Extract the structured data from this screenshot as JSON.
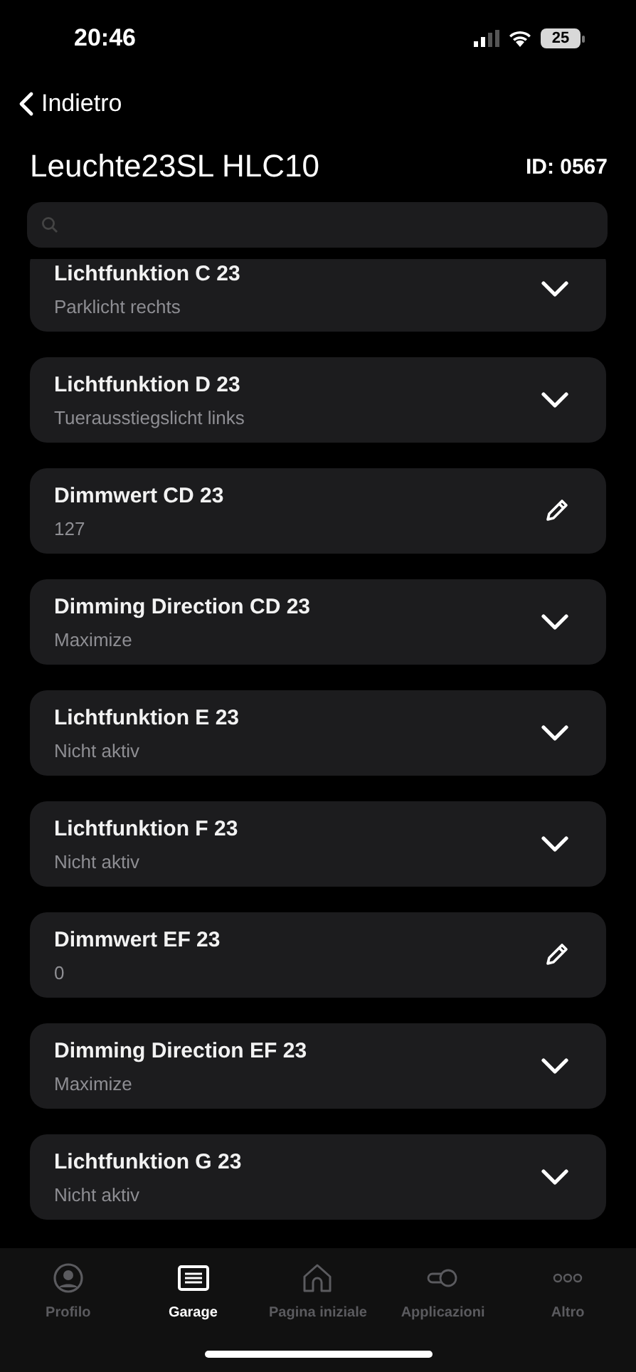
{
  "status_bar": {
    "time": "20:46",
    "battery": "25"
  },
  "nav": {
    "back": "Indietro"
  },
  "header": {
    "title": "Leuchte23SL HLC10",
    "id": "ID: 0567"
  },
  "items": [
    {
      "title": "Lichtfunktion C 23",
      "value": "Parklicht rechts",
      "kind": "select"
    },
    {
      "title": "Lichtfunktion D 23",
      "value": "Tuerausstiegslicht links",
      "kind": "select"
    },
    {
      "title": "Dimmwert CD 23",
      "value": "127",
      "kind": "edit"
    },
    {
      "title": "Dimming Direction CD 23",
      "value": "Maximize",
      "kind": "select"
    },
    {
      "title": "Lichtfunktion E 23",
      "value": "Nicht aktiv",
      "kind": "select"
    },
    {
      "title": "Lichtfunktion F 23",
      "value": "Nicht aktiv",
      "kind": "select"
    },
    {
      "title": "Dimmwert EF 23",
      "value": "0",
      "kind": "edit"
    },
    {
      "title": "Dimming Direction EF 23",
      "value": "Maximize",
      "kind": "select"
    },
    {
      "title": "Lichtfunktion G 23",
      "value": "Nicht aktiv",
      "kind": "select"
    }
  ],
  "tabs": [
    {
      "label": "Profilo",
      "kind": "profile",
      "selected": false
    },
    {
      "label": "Garage",
      "kind": "garage",
      "selected": true
    },
    {
      "label": "Pagina iniziale",
      "kind": "home",
      "selected": false
    },
    {
      "label": "Applicazioni",
      "kind": "apps",
      "selected": false
    },
    {
      "label": "Altro",
      "kind": "more",
      "selected": false
    }
  ]
}
